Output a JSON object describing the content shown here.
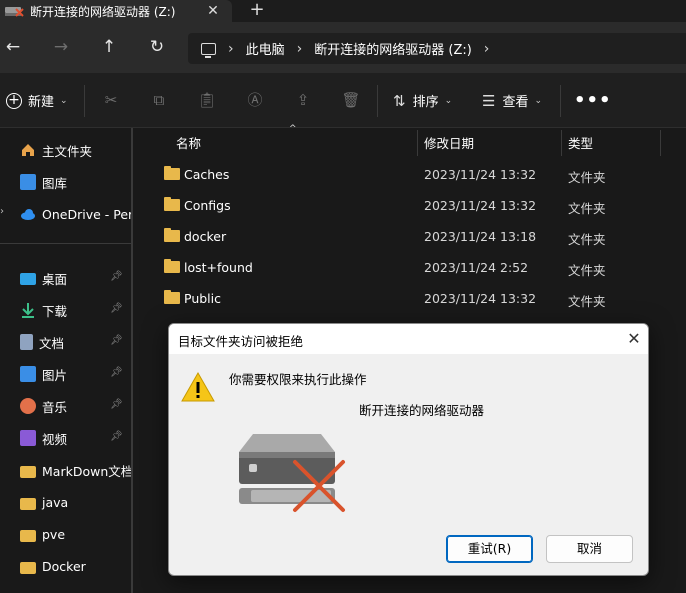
{
  "tab": {
    "title": "断开连接的网络驱动器 (Z:)",
    "close": "✕",
    "add": "+"
  },
  "nav": {
    "back": "←",
    "forward": "→",
    "up": "↑",
    "refresh": "↻"
  },
  "address": {
    "segments": [
      "此电脑",
      "断开连接的网络驱动器 (Z:)"
    ],
    "separator": "›"
  },
  "toolbar": {
    "new_label": "新建",
    "sort_label": "排序",
    "view_label": "查看",
    "more": "•••",
    "icons": [
      "cut-icon",
      "copy-icon",
      "paste-icon",
      "rename-icon",
      "share-icon",
      "delete-icon"
    ]
  },
  "sidebar": {
    "items": [
      {
        "label": "主文件夹",
        "icon": "home-icon"
      },
      {
        "label": "图库",
        "icon": "gallery-icon"
      },
      {
        "label": "OneDrive - Per",
        "icon": "cloud-icon"
      },
      {
        "label": "桌面",
        "icon": "desktop-icon",
        "pinned": true
      },
      {
        "label": "下载",
        "icon": "download-icon",
        "pinned": true
      },
      {
        "label": "文档",
        "icon": "document-icon",
        "pinned": true
      },
      {
        "label": "图片",
        "icon": "pictures-icon",
        "pinned": true
      },
      {
        "label": "音乐",
        "icon": "music-icon",
        "pinned": true
      },
      {
        "label": "视频",
        "icon": "video-icon",
        "pinned": true
      },
      {
        "label": "MarkDown文档",
        "icon": "folder-icon"
      },
      {
        "label": "java",
        "icon": "folder-icon"
      },
      {
        "label": "pve",
        "icon": "folder-icon"
      },
      {
        "label": "Docker",
        "icon": "folder-icon"
      }
    ]
  },
  "columns": {
    "name": "名称",
    "date": "修改日期",
    "type": "类型"
  },
  "files": [
    {
      "name": "Caches",
      "date": "2023/11/24 13:32",
      "type": "文件夹"
    },
    {
      "name": "Configs",
      "date": "2023/11/24 13:32",
      "type": "文件夹"
    },
    {
      "name": "docker",
      "date": "2023/11/24 13:18",
      "type": "文件夹"
    },
    {
      "name": "lost+found",
      "date": "2023/11/24 2:52",
      "type": "文件夹"
    },
    {
      "name": "Public",
      "date": "2023/11/24 13:32",
      "type": "文件夹"
    }
  ],
  "dialog": {
    "title": "目标文件夹访问被拒绝",
    "message": "你需要权限来执行此操作",
    "target": "断开连接的网络驱动器",
    "retry": "重试(R)",
    "cancel": "取消",
    "close": "✕"
  },
  "colors": {
    "folder": "#e8b84b",
    "accent": "#0067c0",
    "warning": "#f5c518",
    "error": "#d9532c"
  }
}
